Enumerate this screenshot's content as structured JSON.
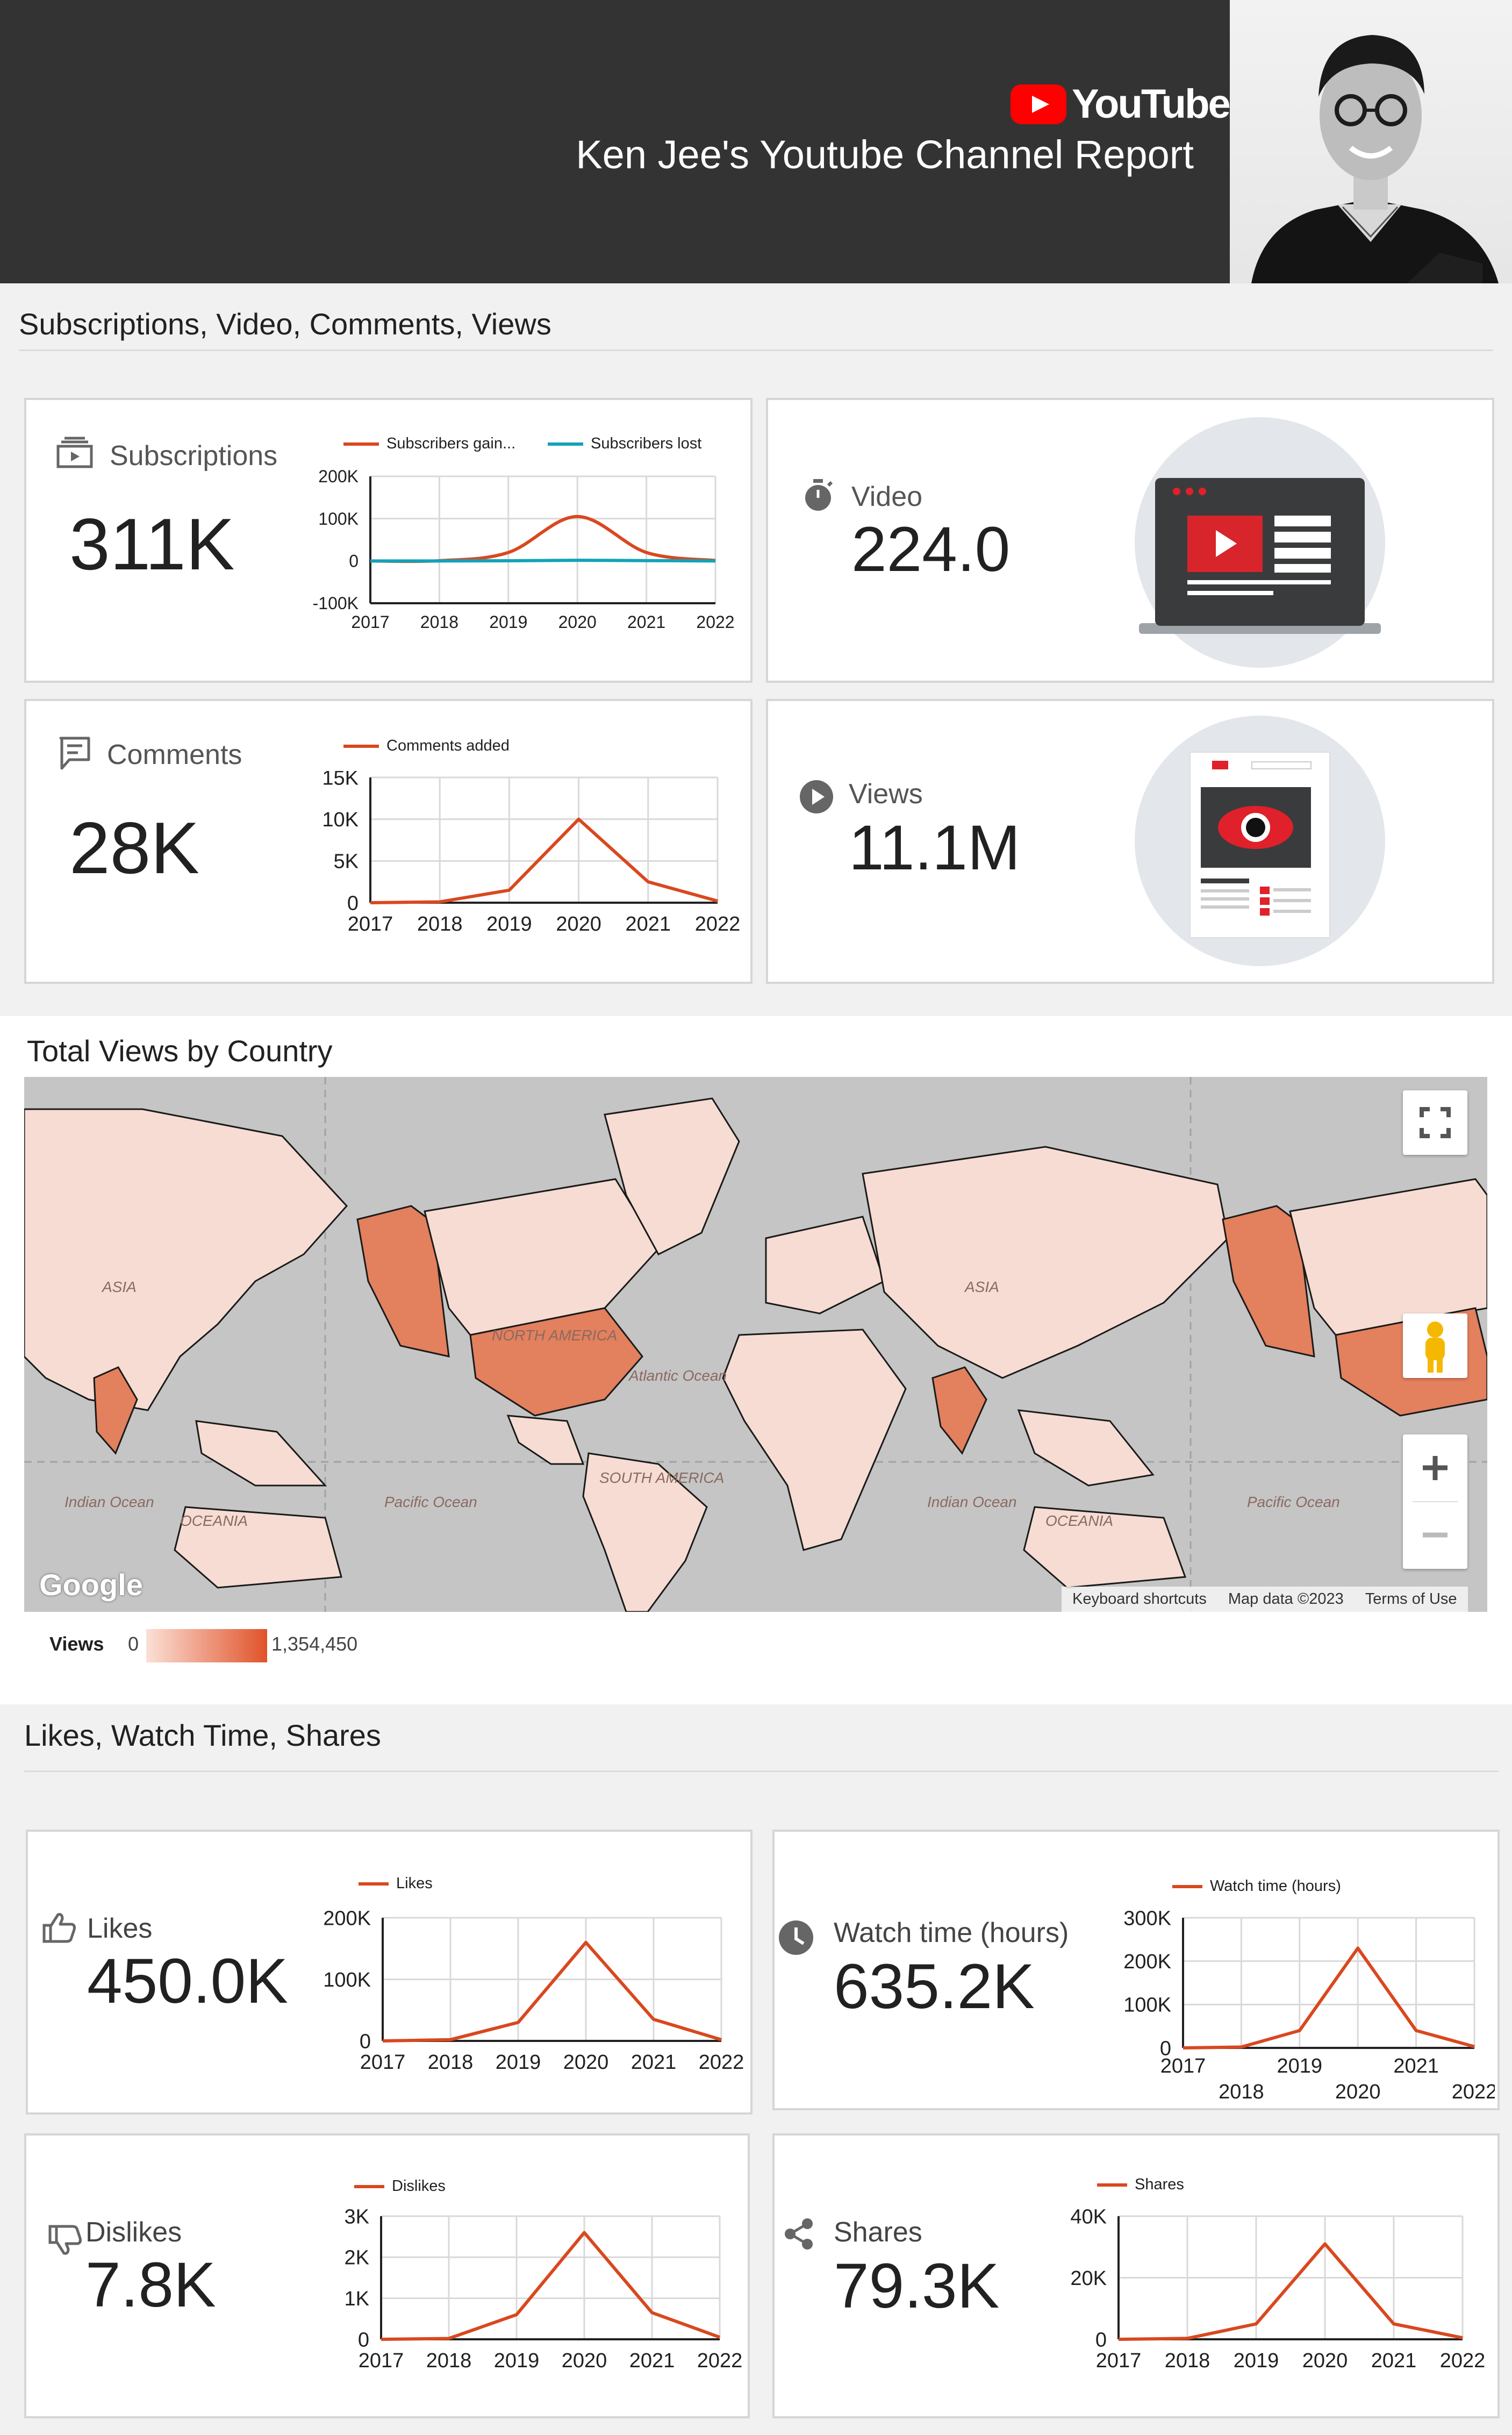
{
  "header": {
    "logo_text": "YouTube",
    "title": "Ken Jee's Youtube Channel Report"
  },
  "section1": {
    "title": "Subscriptions, Video, Comments, Views"
  },
  "kpis": {
    "subscriptions": {
      "label": "Subscriptions",
      "value": "311K",
      "icon": "subscriptions-icon"
    },
    "video": {
      "label": "Video",
      "value": "224.0",
      "icon": "stopwatch-icon"
    },
    "comments": {
      "label": "Comments",
      "value": "28K",
      "icon": "comment-icon"
    },
    "views": {
      "label": "Views",
      "value": "11.1M",
      "icon": "play-circle-icon"
    }
  },
  "section2": {
    "title": "Total Views by Country"
  },
  "map": {
    "labels": [
      "ASIA",
      "NORTH AMERICA",
      "Atlantic Ocean",
      "SOUTH AMERICA",
      "Indian Ocean",
      "Pacific Ocean",
      "OCEANIA"
    ],
    "footer": {
      "shortcuts": "Keyboard shortcuts",
      "data": "Map data ©2023",
      "terms": "Terms of Use"
    },
    "google": "Google",
    "legend": {
      "metric": "Views",
      "min": "0",
      "max": "1,354,450",
      "color_low": "#fbe0d6",
      "color_high": "#e0532a"
    }
  },
  "section3": {
    "title": "Likes, Watch Time, Shares"
  },
  "kpis2": {
    "likes": {
      "label": "Likes",
      "value": "450.0K",
      "icon": "thumbs-up-icon"
    },
    "watch": {
      "label": "Watch time (hours)",
      "value": "635.2K",
      "icon": "clock-icon"
    },
    "dislikes": {
      "label": "Dislikes",
      "value": "7.8K",
      "icon": "thumbs-down-icon"
    },
    "shares": {
      "label": "Shares",
      "value": "79.3K",
      "icon": "share-icon"
    }
  },
  "colors": {
    "series_orange": "#d9481f",
    "series_teal": "#13a3b8",
    "header_bg": "#333333"
  },
  "chart_data": [
    {
      "id": "subs",
      "type": "line",
      "x": [
        2017,
        2018,
        2019,
        2020,
        2021,
        2022
      ],
      "series": [
        {
          "name": "Subscribers gain...",
          "values": [
            0,
            500,
            20000,
            105000,
            20000,
            1000
          ],
          "color": "#d9481f"
        },
        {
          "name": "Subscribers lost",
          "values": [
            0,
            0,
            500,
            1500,
            800,
            0
          ],
          "color": "#13a3b8"
        }
      ],
      "y_ticks": [
        "200K",
        "100K",
        "0",
        "-100K"
      ],
      "ylim": [
        -100000,
        200000
      ],
      "grid": true,
      "legend": "top"
    },
    {
      "id": "comments",
      "type": "line",
      "x": [
        2017,
        2018,
        2019,
        2020,
        2021,
        2022
      ],
      "series": [
        {
          "name": "Comments added",
          "values": [
            0,
            100,
            1500,
            10000,
            2500,
            200
          ],
          "color": "#d9481f"
        }
      ],
      "y_ticks": [
        "15K",
        "10K",
        "5K",
        "0"
      ],
      "ylim": [
        0,
        15000
      ],
      "grid": true,
      "legend": "top"
    },
    {
      "id": "likes",
      "type": "line",
      "x": [
        2017,
        2018,
        2019,
        2020,
        2021,
        2022
      ],
      "series": [
        {
          "name": "Likes",
          "values": [
            0,
            2000,
            30000,
            160000,
            35000,
            2000
          ],
          "color": "#d9481f"
        }
      ],
      "y_ticks": [
        "200K",
        "100K",
        "0"
      ],
      "ylim": [
        0,
        200000
      ],
      "grid": true,
      "legend": "top"
    },
    {
      "id": "watch",
      "type": "line",
      "x": [
        2017,
        2018,
        2019,
        2020,
        2021,
        2022
      ],
      "series": [
        {
          "name": "Watch time (hours)",
          "values": [
            0,
            2000,
            40000,
            230000,
            40000,
            3000
          ],
          "color": "#d9481f"
        }
      ],
      "y_ticks": [
        "300K",
        "200K",
        "100K",
        "0"
      ],
      "ylim": [
        0,
        300000
      ],
      "grid": true,
      "legend": "top"
    },
    {
      "id": "dislikes",
      "type": "line",
      "x": [
        2017,
        2018,
        2019,
        2020,
        2021,
        2022
      ],
      "series": [
        {
          "name": "Dislikes",
          "values": [
            0,
            20,
            600,
            2600,
            650,
            50
          ],
          "color": "#d9481f"
        }
      ],
      "y_ticks": [
        "3K",
        "2K",
        "1K",
        "0"
      ],
      "ylim": [
        0,
        3000
      ],
      "grid": true,
      "legend": "top"
    },
    {
      "id": "shares",
      "type": "line",
      "x": [
        2017,
        2018,
        2019,
        2020,
        2021,
        2022
      ],
      "series": [
        {
          "name": "Shares",
          "values": [
            0,
            300,
            5000,
            31000,
            5000,
            500
          ],
          "color": "#d9481f"
        }
      ],
      "y_ticks": [
        "40K",
        "20K",
        "0"
      ],
      "ylim": [
        0,
        40000
      ],
      "grid": true,
      "legend": "top"
    }
  ]
}
